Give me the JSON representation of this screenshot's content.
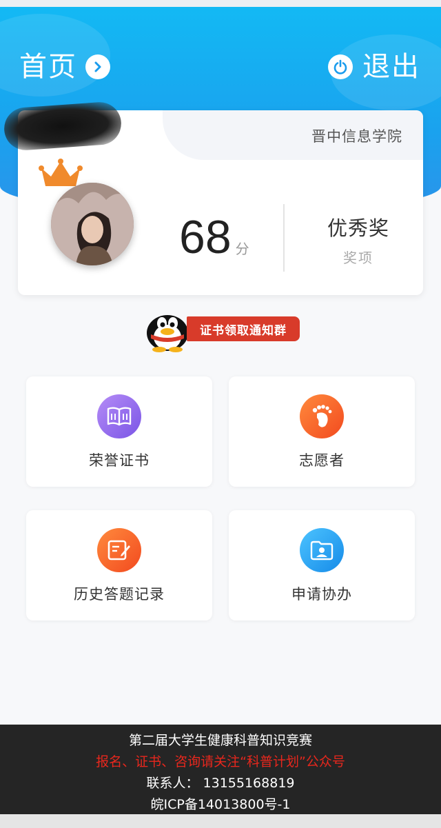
{
  "header": {
    "home_label": "首页",
    "logout_label": "退出",
    "icons": {
      "home_arrow": "chevron-right-icon",
      "logout": "power-icon"
    }
  },
  "profile": {
    "name_redacted": true,
    "school": "晋中信息学院",
    "score": "68",
    "score_unit": "分",
    "award": "优秀奖",
    "award_caption": "奖项"
  },
  "qq_group": {
    "label": "证书领取通知群",
    "icon": "qq-penguin-icon"
  },
  "tiles": [
    {
      "label": "荣誉证书",
      "icon": "book-icon",
      "color": "#8a63ea"
    },
    {
      "label": "志愿者",
      "icon": "footprint-icon",
      "color": "#f5541f"
    },
    {
      "label": "历史答题记录",
      "icon": "edit-note-icon",
      "color": "#f5541f"
    },
    {
      "label": "申请协办",
      "icon": "user-card-icon",
      "color": "#1d95ee"
    }
  ],
  "footer": {
    "line1": "第二届大学生健康科普知识竞赛",
    "line2": "报名、证书、咨询请关注“科普计划”公众号",
    "line3": "联系人： 13155168819",
    "line4": "皖ICP备14013800号-1"
  },
  "colors": {
    "header_blue": "#1aa2ee",
    "footer_bg": "#252525",
    "accent_red": "#e8271d"
  }
}
